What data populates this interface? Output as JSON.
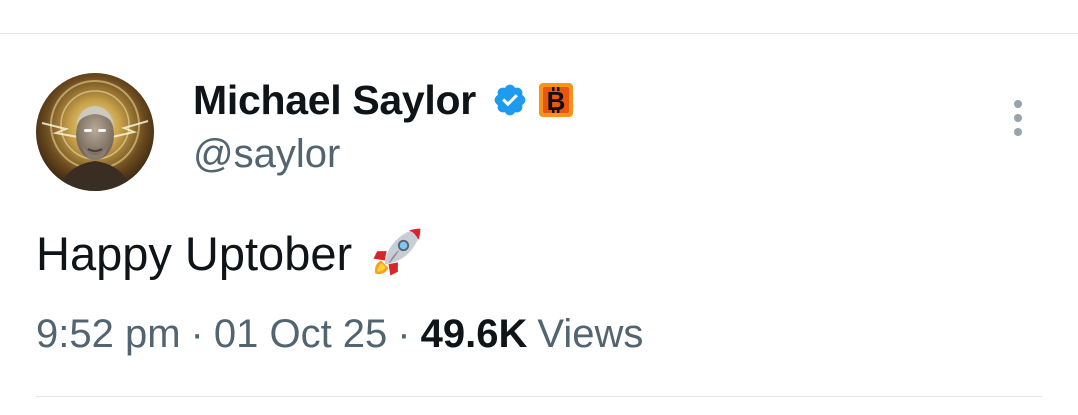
{
  "author": {
    "display_name": "Michael Saylor",
    "handle": "@saylor",
    "verified": true,
    "affiliate_badge": "bitcoin-icon"
  },
  "tweet": {
    "text": "Happy Uptober",
    "emoji": "rocket-icon"
  },
  "meta": {
    "time": "9:52 pm",
    "separator": "·",
    "date": "01 Oct 25",
    "views_count": "49.6K",
    "views_label": "Views"
  },
  "icons": {
    "more": "more-vertical-icon",
    "verified": "verified-badge-icon"
  },
  "colors": {
    "verified_blue": "#1d9bf0",
    "bitcoin_orange": "#f7931a",
    "text_primary": "#0f1419",
    "text_secondary": "#536471",
    "divider": "#e4e7ea"
  }
}
